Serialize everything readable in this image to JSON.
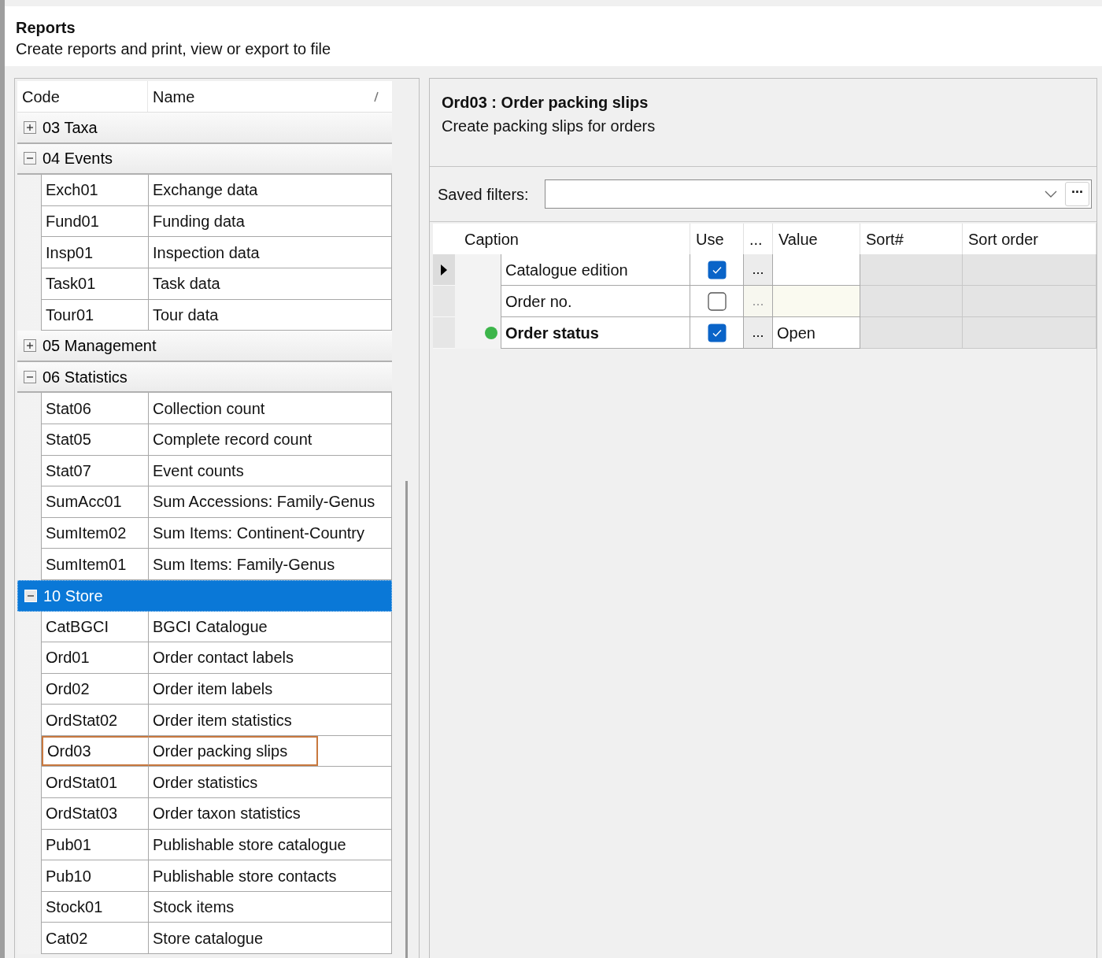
{
  "header": {
    "title": "Reports",
    "subtitle": "Create reports and print, view or export to file"
  },
  "tree": {
    "columns": [
      "Code",
      "Name"
    ],
    "groups": [
      {
        "label": "03 Taxa",
        "expanded": false,
        "selected": false
      },
      {
        "label": "04 Events",
        "expanded": true,
        "selected": false,
        "children": [
          {
            "code": "Exch01",
            "name": "Exchange data",
            "highlighted": false
          },
          {
            "code": "Fund01",
            "name": "Funding data",
            "highlighted": false
          },
          {
            "code": "Insp01",
            "name": "Inspection data",
            "highlighted": false
          },
          {
            "code": "Task01",
            "name": "Task data",
            "highlighted": false
          },
          {
            "code": "Tour01",
            "name": "Tour data",
            "highlighted": false
          }
        ]
      },
      {
        "label": "05 Management",
        "expanded": false,
        "selected": false
      },
      {
        "label": "06 Statistics",
        "expanded": true,
        "selected": false,
        "children": [
          {
            "code": "Stat06",
            "name": "Collection count",
            "highlighted": false
          },
          {
            "code": "Stat05",
            "name": "Complete record count",
            "highlighted": false
          },
          {
            "code": "Stat07",
            "name": "Event counts",
            "highlighted": false
          },
          {
            "code": "SumAcc01",
            "name": "Sum Accessions: Family-Genus",
            "highlighted": false
          },
          {
            "code": "SumItem02",
            "name": "Sum Items: Continent-Country",
            "highlighted": false
          },
          {
            "code": "SumItem01",
            "name": "Sum Items: Family-Genus",
            "highlighted": false
          }
        ]
      },
      {
        "label": "10 Store",
        "expanded": true,
        "selected": true,
        "children": [
          {
            "code": "CatBGCI",
            "name": "BGCI Catalogue",
            "highlighted": false
          },
          {
            "code": "Ord01",
            "name": "Order contact labels",
            "highlighted": false
          },
          {
            "code": "Ord02",
            "name": "Order item labels",
            "highlighted": false
          },
          {
            "code": "OrdStat02",
            "name": "Order item statistics",
            "highlighted": false
          },
          {
            "code": "Ord03",
            "name": "Order packing slips",
            "highlighted": true
          },
          {
            "code": "OrdStat01",
            "name": "Order statistics",
            "highlighted": false
          },
          {
            "code": "OrdStat03",
            "name": "Order taxon statistics",
            "highlighted": false
          },
          {
            "code": "Pub01",
            "name": "Publishable store catalogue",
            "highlighted": false
          },
          {
            "code": "Pub10",
            "name": "Publishable store contacts",
            "highlighted": false
          },
          {
            "code": "Stock01",
            "name": "Stock items",
            "highlighted": false
          },
          {
            "code": "Cat02",
            "name": "Store catalogue",
            "highlighted": false
          }
        ]
      }
    ]
  },
  "report": {
    "title": "Ord03 : Order packing slips",
    "description": "Create packing slips for orders"
  },
  "saved_filters": {
    "label": "Saved filters:",
    "button": "..."
  },
  "filter_grid": {
    "columns": [
      "Caption",
      "Use",
      "...",
      "Value",
      "Sort#",
      "Sort order"
    ],
    "rows": [
      {
        "caption": "Catalogue edition",
        "checked": true,
        "ellipsis": "...",
        "current": true,
        "active": false
      },
      {
        "caption": "Order no.",
        "checked": false,
        "ellipsis": "...",
        "current": false,
        "active": false
      },
      {
        "caption": "Order status",
        "checked": true,
        "ellipsis": "...",
        "value": "Open",
        "current": false,
        "active": true
      }
    ]
  }
}
